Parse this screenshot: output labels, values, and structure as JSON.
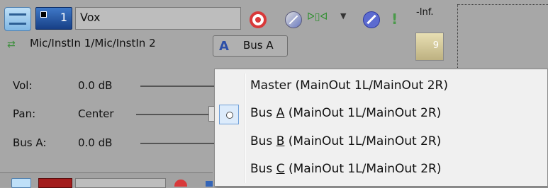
{
  "track": {
    "number": "1",
    "name": "Vox",
    "peak_label": "-Inf.",
    "meter_value": "9",
    "routing_text": "Mic/InstIn 1/Mic/InstIn 2",
    "bus_button_label": "Bus A"
  },
  "icons": {
    "minimize": "minimize-track-icon",
    "record": "record-arm-icon",
    "phase": "invert-phase-icon",
    "fx": "track-fx-icon",
    "mute": "mute-icon",
    "solo": "solo-icon",
    "input": "input-routing-icon",
    "bus": "bus-a-icon"
  },
  "params": [
    {
      "label": "Vol:",
      "value": "0.0 dB"
    },
    {
      "label": "Pan:",
      "value": "Center"
    },
    {
      "label": "Bus A:",
      "value": "0.0 dB"
    }
  ],
  "menu": {
    "items": [
      {
        "pre": "Master",
        "key": "",
        "post": " (MainOut 1L/MainOut 2R)",
        "checked": false
      },
      {
        "pre": "Bus ",
        "key": "A",
        "post": "  (MainOut 1L/MainOut 2R)",
        "checked": true
      },
      {
        "pre": "Bus ",
        "key": "B",
        "post": "  (MainOut 1L/MainOut 2R)",
        "checked": false
      },
      {
        "pre": "Bus ",
        "key": "C",
        "post": "  (MainOut 1L/MainOut 2R)",
        "checked": false
      }
    ]
  },
  "colors": {
    "panel_bg": "#a7a7a7",
    "menu_bg": "#f0f0f0",
    "record_red": "#d8393a",
    "track_blue": "#2a5aa8"
  }
}
